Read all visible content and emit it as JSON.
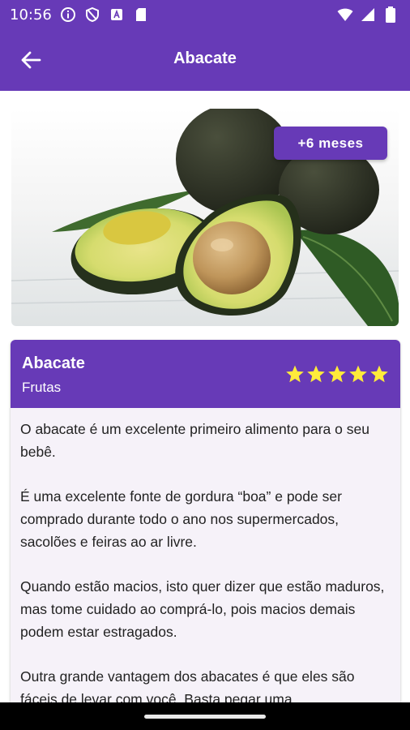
{
  "status": {
    "time": "10:56",
    "icons_left": [
      "info-icon",
      "shield-icon",
      "font-icon",
      "sd-card-icon"
    ],
    "icons_right": [
      "wifi-icon",
      "signal-icon",
      "battery-icon"
    ]
  },
  "app_bar": {
    "title": "Abacate",
    "back_icon": "arrow-back-icon"
  },
  "hero": {
    "image": "avocado-photo",
    "badge": "+6 meses"
  },
  "card": {
    "name": "Abacate",
    "category": "Frutas",
    "rating": 5,
    "paragraphs": [
      "O abacate é um excelente primeiro alimento para o seu bebê.",
      "É uma excelente fonte de gordura “boa” e pode ser comprado durante todo o ano nos supermercados, sacolões e feiras ao ar livre.",
      "Quando estão macios, isto quer dizer que estão maduros, mas tome cuidado ao comprá-lo, pois macios demais podem estar estragados.",
      "Outra grande vantagem dos abacates é que eles são fáceis de levar com você. Basta pegar uma"
    ]
  },
  "colors": {
    "primary": "#673ab7",
    "star": "#ffeb3b",
    "card_bg": "#f6f2f9"
  }
}
